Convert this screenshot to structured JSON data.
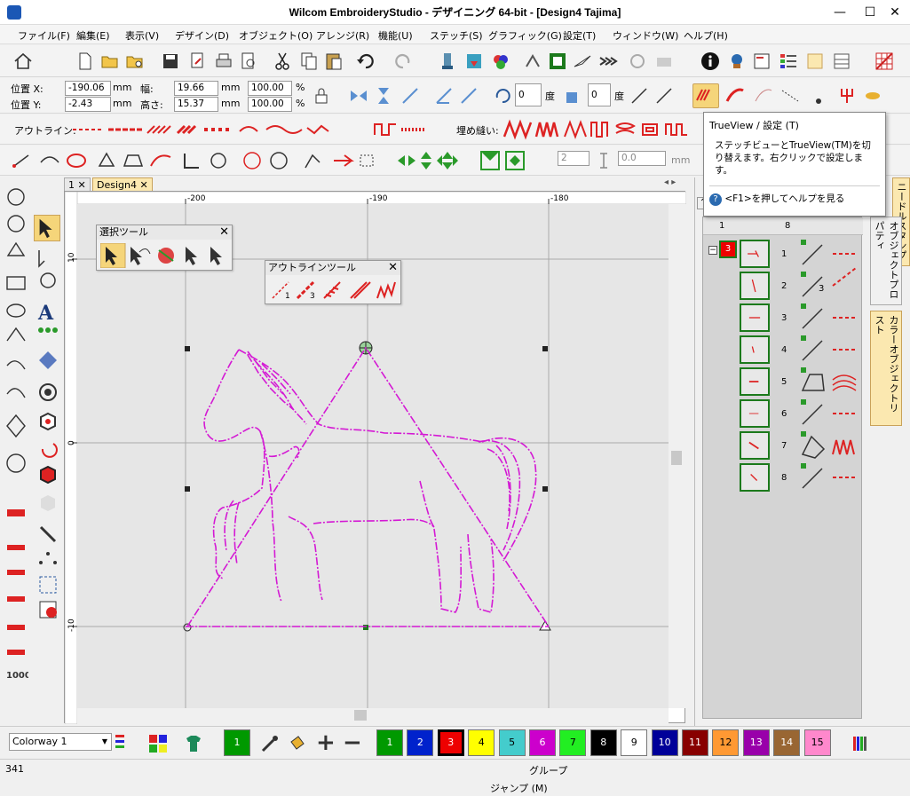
{
  "window": {
    "title": "Wilcom EmbroideryStudio - デザイニング 64-bit - [Design4     Tajima]",
    "minimize": "—",
    "maximize": "☐",
    "close": "✕"
  },
  "menu": [
    "ファイル(F)",
    "編集(E)",
    "表示(V)",
    "デザイン(D)",
    "オブジェクト(O)",
    "アレンジ(R)",
    "機能(U)",
    "ステッチ(S)",
    "グラフィック(G)",
    "設定(T)",
    "ウィンドウ(W)",
    "ヘルプ(H)"
  ],
  "position": {
    "x_label": "位置 X:",
    "x_value": "-190.06",
    "y_label": "位置 Y:",
    "y_value": "-2.43",
    "unit": "mm",
    "width_label": "幅:",
    "width_value": "19.66",
    "height_label": "高さ:",
    "height_value": "15.37",
    "scale_w": "100.00",
    "scale_h": "100.00",
    "pct": "%"
  },
  "rotate": {
    "value1": "0",
    "value2": "0",
    "deg": "度"
  },
  "outline_bar": {
    "label": "アウトライン:",
    "fill_label": "埋め縫い:"
  },
  "small_fields": {
    "count": "2",
    "value": "0.0",
    "unit": "mm"
  },
  "tabs": {
    "tab1": "1",
    "tab2": "Design4"
  },
  "rulers": {
    "x": [
      "-200",
      "-190",
      "-180"
    ],
    "y": [
      "10",
      "0",
      "-10"
    ]
  },
  "select_tool": {
    "title": "選択ツール"
  },
  "outline_tool": {
    "title": "アウトラインツール"
  },
  "tooltip": {
    "title": "TrueView / 設定 (T)",
    "body": "ステッチビューとTrueView(TM)を切り替えます。右クリックで設定します。",
    "help": "<F1>を押してヘルプを見る"
  },
  "side_tabs": {
    "needle": "ニードルスタンプ",
    "props": "オブジェクトプロパティ",
    "list": "カラーオブジェクトリスト"
  },
  "object_list": {
    "col1": "1",
    "col2": "8",
    "color_block": "3",
    "rows": [
      "1",
      "2",
      "3",
      "4",
      "5",
      "6",
      "7",
      "8"
    ],
    "row2_sub": "3"
  },
  "colorway": {
    "label": "Colorway 1",
    "current": "1"
  },
  "palette": [
    {
      "n": "1",
      "c": "#009900",
      "t": "#fff"
    },
    {
      "n": "2",
      "c": "#0022cc",
      "t": "#fff"
    },
    {
      "n": "3",
      "c": "#ee0000",
      "t": "#fff"
    },
    {
      "n": "4",
      "c": "#ffff00",
      "t": "#000"
    },
    {
      "n": "5",
      "c": "#44cccc",
      "t": "#000"
    },
    {
      "n": "6",
      "c": "#cc00cc",
      "t": "#fff"
    },
    {
      "n": "7",
      "c": "#22ee22",
      "t": "#000"
    },
    {
      "n": "8",
      "c": "#000000",
      "t": "#fff"
    },
    {
      "n": "9",
      "c": "#ffffff",
      "t": "#000"
    },
    {
      "n": "10",
      "c": "#000099",
      "t": "#fff"
    },
    {
      "n": "11",
      "c": "#880000",
      "t": "#fff"
    },
    {
      "n": "12",
      "c": "#ff9933",
      "t": "#000"
    },
    {
      "n": "13",
      "c": "#9900aa",
      "t": "#fff"
    },
    {
      "n": "14",
      "c": "#996633",
      "t": "#fff"
    },
    {
      "n": "15",
      "c": "#ff88cc",
      "t": "#000"
    }
  ],
  "status": {
    "count": "341",
    "center": "グループ",
    "bottom": "ジャンプ (M)"
  },
  "colors": {
    "magenta": "#d419d4",
    "accent": "#1c7a1c"
  }
}
